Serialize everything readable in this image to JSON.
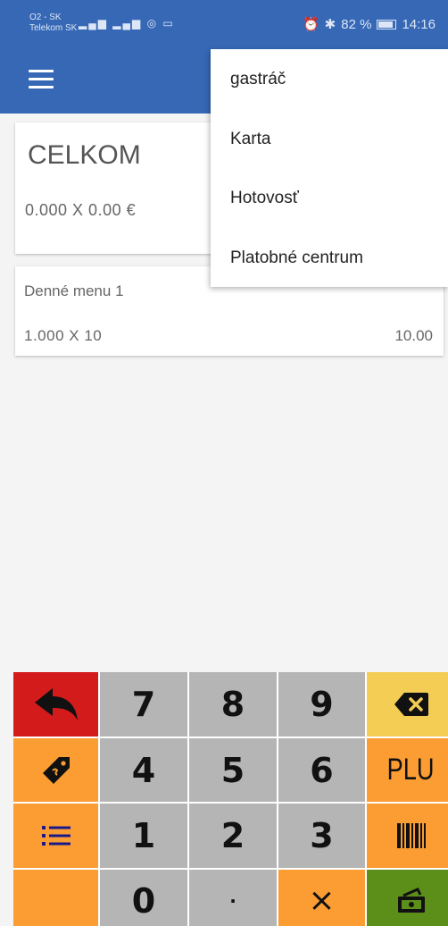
{
  "status_bar": {
    "carrier_line1": "O2 - SK",
    "carrier_line2": "Telekom SK",
    "battery_percent": "82 %",
    "time": "14:16",
    "icons": [
      "alarm-icon",
      "bluetooth-icon",
      "battery-icon",
      "signal-icon",
      "wifi-icon"
    ]
  },
  "app_bar": {
    "color": "#3668b5"
  },
  "total": {
    "title": "CELKOM",
    "summary": "0.000  X  0.00  €"
  },
  "items": [
    {
      "name": "Denné menu 1",
      "qty": "1.000  X  10",
      "price": "10.00"
    }
  ],
  "payment_menu": [
    "gastráč",
    "Karta",
    "Hotovosť",
    "Platobné centrum"
  ],
  "keypad": {
    "digits": {
      "seven": "7",
      "eight": "8",
      "nine": "9",
      "four": "4",
      "five": "5",
      "six": "6",
      "one": "1",
      "two": "2",
      "three": "3",
      "zero": "0"
    },
    "dot": "·",
    "times": "×",
    "plu": "PLU",
    "colors": {
      "red": "#d31b1b",
      "grey": "#b5b5b5",
      "yellow": "#f4cd54",
      "orange": "#fb9d33",
      "green": "#5c8f1a"
    }
  }
}
